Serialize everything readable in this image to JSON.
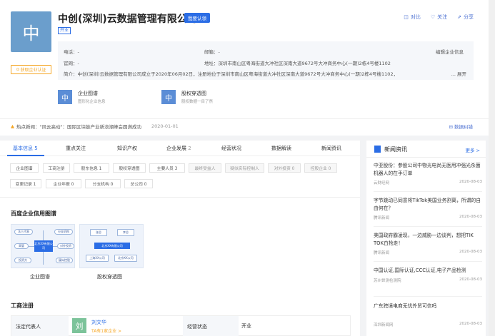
{
  "company": {
    "logo_char": "中",
    "name": "中创(深圳)云数据管理有限公司",
    "auth_button": "我要认领",
    "status": "开业",
    "claim_label": "获取企业认证"
  },
  "top_actions": [
    {
      "icon": "compare-icon",
      "label": "对比"
    },
    {
      "icon": "heart-icon",
      "label": "关注"
    },
    {
      "icon": "share-icon",
      "label": "分享"
    }
  ],
  "info": {
    "phone": "电话：-",
    "email": "邮箱：-",
    "website": "官网：-",
    "address": "地址：深圳市南山区粤海街道大冲社区深南大道9672号大冲商务中心(一期)2栋4号楼1102",
    "intro": "简介：中创(深圳)云数据管理有限公司成立于2020年06月02日，注册地位于深圳市南山区粤海街道大冲社区深南大道9672号大冲商务中心(一期)2栋4号楼1102，",
    "edit_link": "编辑企业信息",
    "expand_link": "... 展开"
  },
  "cards": [
    {
      "icon_char": "中",
      "title": "企业图谱",
      "sub": "图形化企业信息"
    },
    {
      "icon_char": "中",
      "title": "股权穿透图",
      "sub": "股权数据一目了然"
    }
  ],
  "hot_news": {
    "label": "热点新闻：\"风云高动\"：国际区块链产业新浪潮峰会圆满成功",
    "date": "2020-01-01",
    "error_link": "数据纠错"
  },
  "tabs": [
    {
      "label": "基本信息",
      "count": "5"
    },
    {
      "label": "重点关注",
      "count": ""
    },
    {
      "label": "知识产权",
      "count": ""
    },
    {
      "label": "企业发展",
      "count": "2"
    },
    {
      "label": "经营状况",
      "count": ""
    },
    {
      "label": "数据解读",
      "count": ""
    },
    {
      "label": "新闻资讯",
      "count": ""
    }
  ],
  "chips_row1": [
    "企业图谱",
    "工商注册",
    "股东信息 1",
    "股权穿透图",
    "主要人员 3",
    "最终受益人",
    "疑似实际控制人",
    "对外投资 0",
    "控股企业 0"
  ],
  "chips_row2": [
    "变更记录 1",
    "企业年报 0",
    "分支机构 0",
    "总公司 0"
  ],
  "credit_section": {
    "title": "百度企业信用图谱",
    "graph_label": "企业图谱",
    "equity_label": "股权穿透图",
    "graph_nodes": [
      "法人代表",
      "分支机构",
      "高管",
      "对外投资",
      "投资方",
      "疑似控股",
      "北京XX有限公司"
    ],
    "equity_nodes": [
      "张总",
      "李总",
      "北京XX有限公司",
      "上海XX公司",
      "北京XX公司"
    ]
  },
  "registration": {
    "title": "工商注册",
    "legal_rep_label": "法定代表人",
    "legal_rep_avatar": "刘",
    "legal_rep_name": "刘文华",
    "legal_rep_sub": "TA有1家企业 >",
    "status_label": "经营状态",
    "status_value": "开业"
  },
  "news_panel": {
    "title": "新闻资讯",
    "more": "更多 >",
    "items": [
      {
        "title": "中亚股份：参股公司中物光电尚无医用冲强光杀菌机器人的在手订单",
        "source": "云财经网",
        "date": "2020-08-03"
      },
      {
        "title": "字节跳动已同意将TikTok美国业务割离，所谓的自由何在？",
        "source": "腾讯新闻",
        "date": "2020-08-03"
      },
      {
        "title": "美国政府霸凌现，一边威胁一边谈判，想把TIK TOK白抢走！",
        "source": "腾讯新闻",
        "date": "2020-08-03"
      },
      {
        "title": "中国认证,国际认证,CCC认证,电子产品检测",
        "source": "苏州世测检测院",
        "date": "2020-08-03"
      },
      {
        "title": "广东跨境电商无忧外贸可信吗",
        "source": "深圳新闻网",
        "date": "2020-08-03"
      }
    ]
  },
  "colors": {
    "accent": "#2b6de5",
    "logo_bg": "#6b9ecc",
    "warning": "#f5a623"
  }
}
